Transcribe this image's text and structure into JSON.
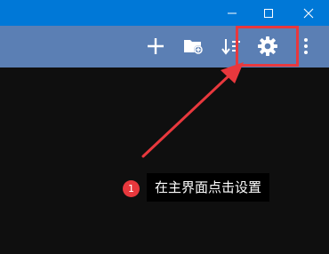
{
  "colors": {
    "titlebar": "#0078d7",
    "toolbar": "#5b7fb4",
    "content": "#0f0f0f",
    "annotation": "#e8383d",
    "icon": "#ffffff"
  },
  "titlebar": {
    "buttons": [
      {
        "icon": "minimize-icon"
      },
      {
        "icon": "maximize-icon"
      },
      {
        "icon": "close-icon"
      }
    ]
  },
  "toolbar": {
    "buttons": [
      {
        "icon": "plus-icon"
      },
      {
        "icon": "add-folder-icon"
      },
      {
        "icon": "sort-icon"
      },
      {
        "icon": "gear-icon"
      },
      {
        "icon": "more-vertical-icon"
      }
    ]
  },
  "annotation": {
    "step_number": "1",
    "instruction": "在主界面点击设置"
  }
}
